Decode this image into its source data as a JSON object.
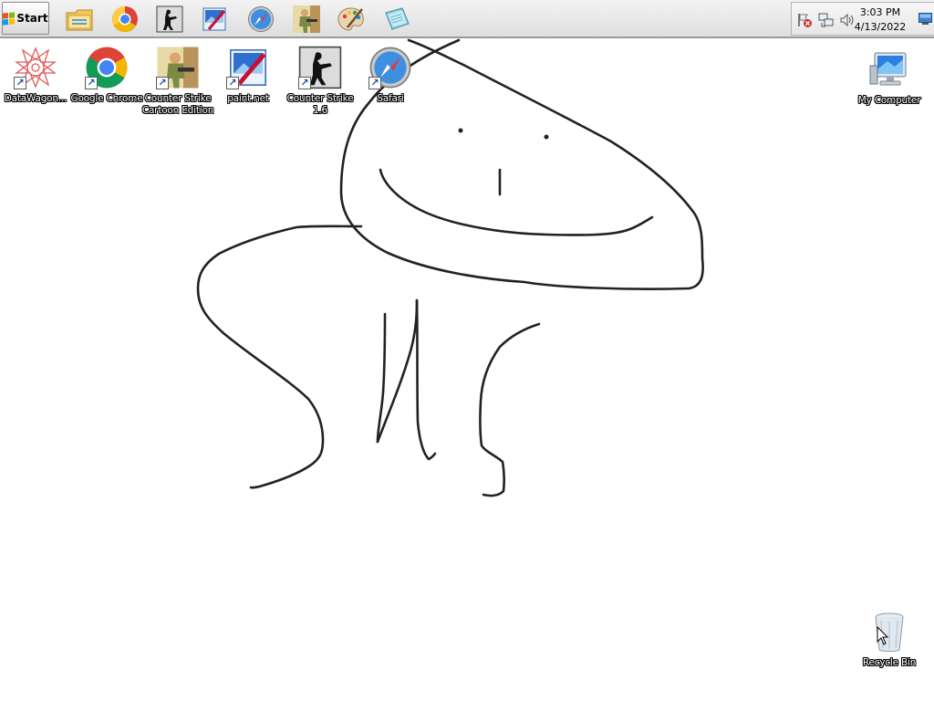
{
  "taskbar": {
    "start_label": "Start",
    "quick_launch": [
      {
        "name": "windows-explorer-icon"
      },
      {
        "name": "chrome-icon"
      },
      {
        "name": "counter-strike-icon"
      },
      {
        "name": "paint-net-icon"
      },
      {
        "name": "safari-icon"
      },
      {
        "name": "counter-strike-cartoon-icon"
      },
      {
        "name": "paint-palette-icon"
      },
      {
        "name": "notepad-icon"
      }
    ],
    "tray": {
      "icons": [
        "action-center-flag-icon",
        "network-icon",
        "volume-icon"
      ],
      "time": "3:03 PM",
      "date": "4/13/2022"
    }
  },
  "desktop": {
    "icons": [
      {
        "label": "DataWagon...",
        "icon": "datawagon-icon",
        "shortcut": true
      },
      {
        "label": "Google Chrome",
        "icon": "chrome-icon",
        "shortcut": true
      },
      {
        "label": "Counter Strike Cartoon Edition",
        "icon": "counter-strike-cartoon-icon",
        "shortcut": true
      },
      {
        "label": "paint.net",
        "icon": "paint-net-icon",
        "shortcut": true
      },
      {
        "label": "Counter Strike 1.6",
        "icon": "counter-strike-icon",
        "shortcut": true
      },
      {
        "label": "Safari",
        "icon": "safari-icon",
        "shortcut": true
      },
      {
        "label": "My Computer",
        "icon": "computer-icon",
        "shortcut": false
      },
      {
        "label": "Recycle Bin",
        "icon": "recycle-bin-icon",
        "shortcut": false
      }
    ]
  },
  "colors": {
    "desktop_background": "#ffffff",
    "taskbar": "#e4e4e4",
    "drawing_stroke": "#222222"
  }
}
